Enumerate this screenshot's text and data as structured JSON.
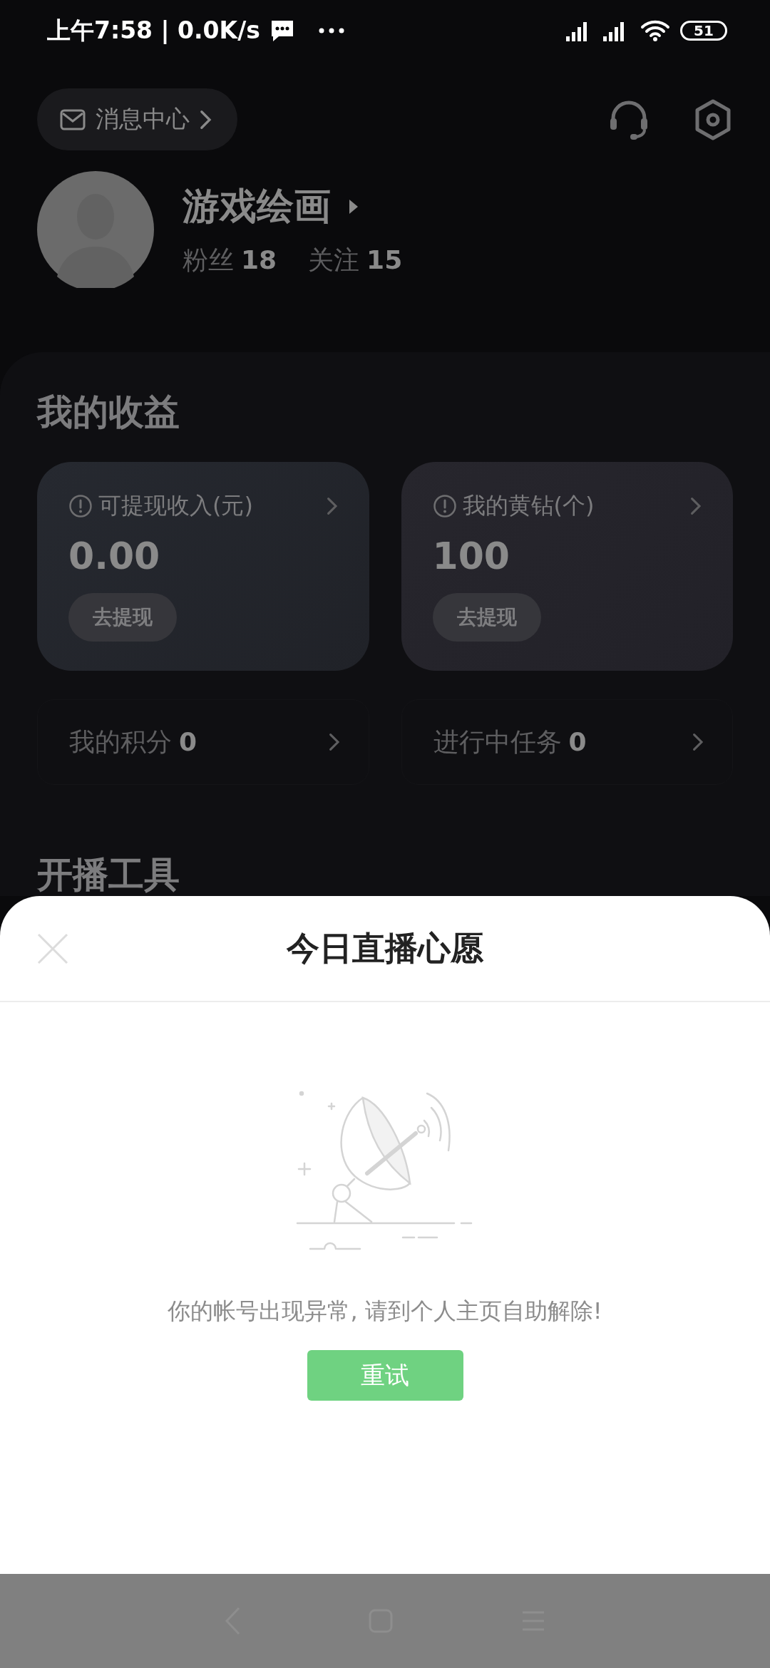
{
  "status_bar": {
    "time": "上午7:58 | 0.0K/s",
    "battery": "51"
  },
  "header": {
    "message_center": "消息中心"
  },
  "profile": {
    "name": "游戏绘画",
    "stats": [
      {
        "label": "粉丝",
        "value": "18"
      },
      {
        "label": "关注",
        "value": "15"
      }
    ]
  },
  "earnings": {
    "title": "我的收益",
    "cards": [
      {
        "label": "可提现收入(元)",
        "value": "0.00",
        "button": "去提现"
      },
      {
        "label": "我的黄钻(个)",
        "value": "100",
        "button": "去提现"
      }
    ]
  },
  "rows": [
    {
      "label": "我的积分",
      "value": "0"
    },
    {
      "label": "进行中任务",
      "value": "0"
    }
  ],
  "tools_title": "开播工具",
  "sheet": {
    "title": "今日直播心愿",
    "message": "你的帐号出现异常, 请到个人主页自助解除!",
    "button": "重试"
  }
}
